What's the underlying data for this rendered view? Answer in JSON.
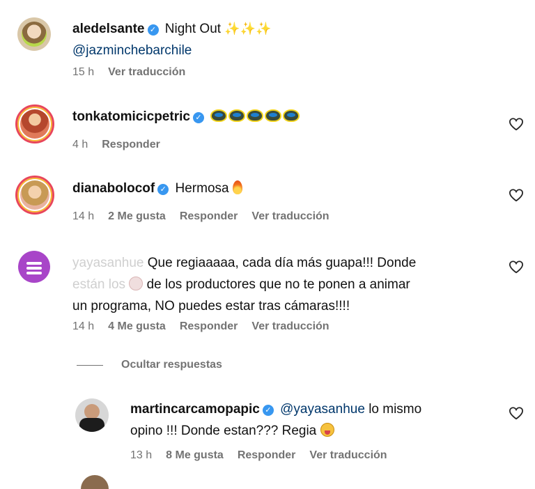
{
  "comments": [
    {
      "username": "aledelsante",
      "text": "Night Out",
      "mention": "@jazminchebarchile",
      "time": "15 h",
      "translate": "Ver traducción"
    },
    {
      "username": "tonkatomicicpetric",
      "time": "4 h",
      "reply": "Responder"
    },
    {
      "username": "dianabolocof",
      "text": "Hermosa",
      "time": "14 h",
      "likes": "2 Me gusta",
      "reply": "Responder",
      "translate": "Ver traducción"
    },
    {
      "username": "yayasanhue",
      "text_a": "Que regiaaaaa, cada día más guapa!!! Donde",
      "text_b_faded": "están los",
      "text_b": "de los productores que no te ponen a animar",
      "text_c": "un programa, NO puedes estar tras cámaras!!!!",
      "time": "14 h",
      "likes": "4 Me gusta",
      "reply": "Responder",
      "translate": "Ver traducción"
    }
  ],
  "hide_replies": "Ocultar respuestas",
  "reply_comment": {
    "username": "martincarcamopapic",
    "mention": "@yayasanhue",
    "text_a": "lo mismo",
    "text_b": "opino !!! Donde estan??? Regia",
    "time": "13 h",
    "likes": "8 Me gusta",
    "reply": "Responder",
    "translate": "Ver traducción"
  },
  "icons": {
    "verified": "verified-badge-icon",
    "heart": "heart-outline-icon"
  },
  "colors": {
    "verified": "#3897f0",
    "meta": "#737373",
    "mention": "#00376b"
  }
}
